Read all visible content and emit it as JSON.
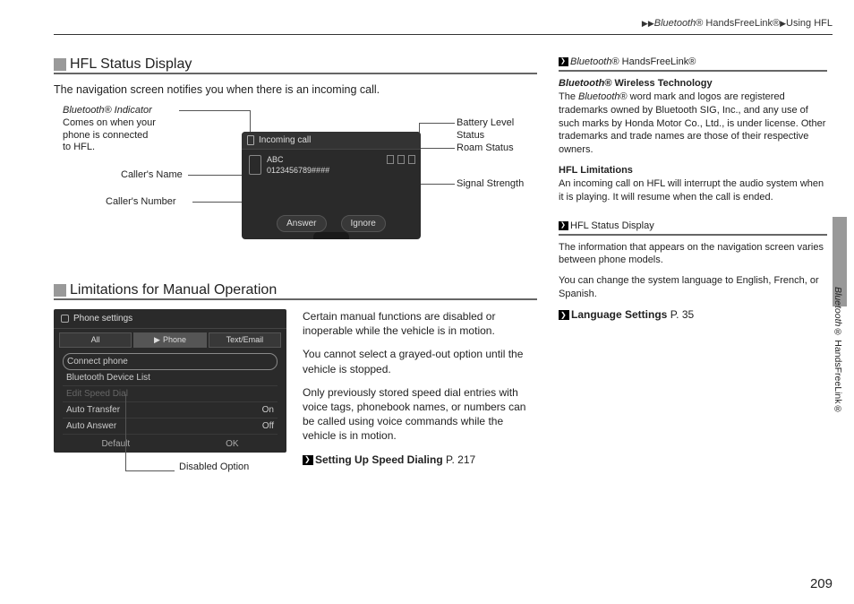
{
  "breadcrumb": {
    "part1": "Bluetooth",
    "reg": "®",
    "part2": "HandsFreeLink",
    "part3": "Using HFL"
  },
  "section1": {
    "title": "HFL Status Display",
    "intro": "The navigation screen notifies you when there is an incoming call.",
    "callouts": {
      "bt_indicator_1": "Bluetooth® Indicator",
      "bt_indicator_2": "Comes on when your",
      "bt_indicator_3": "phone is connected",
      "bt_indicator_4": "to HFL.",
      "caller_name": "Caller's Name",
      "caller_number": "Caller's Number",
      "battery": "Battery Level Status",
      "roam": "Roam Status",
      "signal": "Signal Strength"
    },
    "screen": {
      "incoming": "Incoming call",
      "name": "ABC",
      "number": "0123456789####",
      "answer": "Answer",
      "ignore": "Ignore"
    }
  },
  "section2": {
    "title": "Limitations for Manual Operation",
    "screen": {
      "header": "Phone settings",
      "tab_all": "All",
      "tab_phone": "Phone",
      "tab_text": "Text/Email",
      "li_connect": "Connect phone",
      "li_bdl": "Bluetooth Device List",
      "li_esd": "Edit Speed Dial",
      "li_at": "Auto Transfer",
      "li_at_val": "On",
      "li_aa": "Auto Answer",
      "li_aa_val": "Off",
      "foot_default": "Default",
      "foot_ok": "OK"
    },
    "disabled_label": "Disabled Option",
    "text": {
      "p1": "Certain manual functions are disabled or inoperable while the vehicle is in motion.",
      "p2": "You cannot select a grayed-out option until the vehicle is stopped.",
      "p3": "Only previously stored speed dial entries with voice tags, phonebook names, or numbers can be called using voice commands while the vehicle is in motion.",
      "ref_label": "Setting Up Speed Dialing",
      "ref_page": "P. 217"
    }
  },
  "sidebar": {
    "heading1_a": "Bluetooth",
    "heading1_b": "® HandsFreeLink®",
    "wireless_title_a": "Bluetooth",
    "wireless_title_b": "® Wireless Technology",
    "wireless_body_a": "The ",
    "wireless_body_b": "Bluetooth",
    "wireless_body_c": "® word mark and logos are registered trademarks owned by Bluetooth SIG, Inc., and any use of such marks by Honda Motor Co., Ltd., is under license. Other trademarks and trade names are those of their respective owners.",
    "hfl_lim_title": "HFL Limitations",
    "hfl_lim_body": "An incoming call on HFL will interrupt the audio system when it is playing. It will resume when the call is ended.",
    "heading2": "HFL Status Display",
    "status_body1": "The information that appears on the navigation screen varies between phone models.",
    "status_body2": "You can change the system language to English, French, or Spanish.",
    "ref2_label": "Language Settings",
    "ref2_page": "P. 35"
  },
  "side_label_a": "Bluetooth",
  "side_label_b": "® HandsFreeLink®",
  "page_number": "209"
}
